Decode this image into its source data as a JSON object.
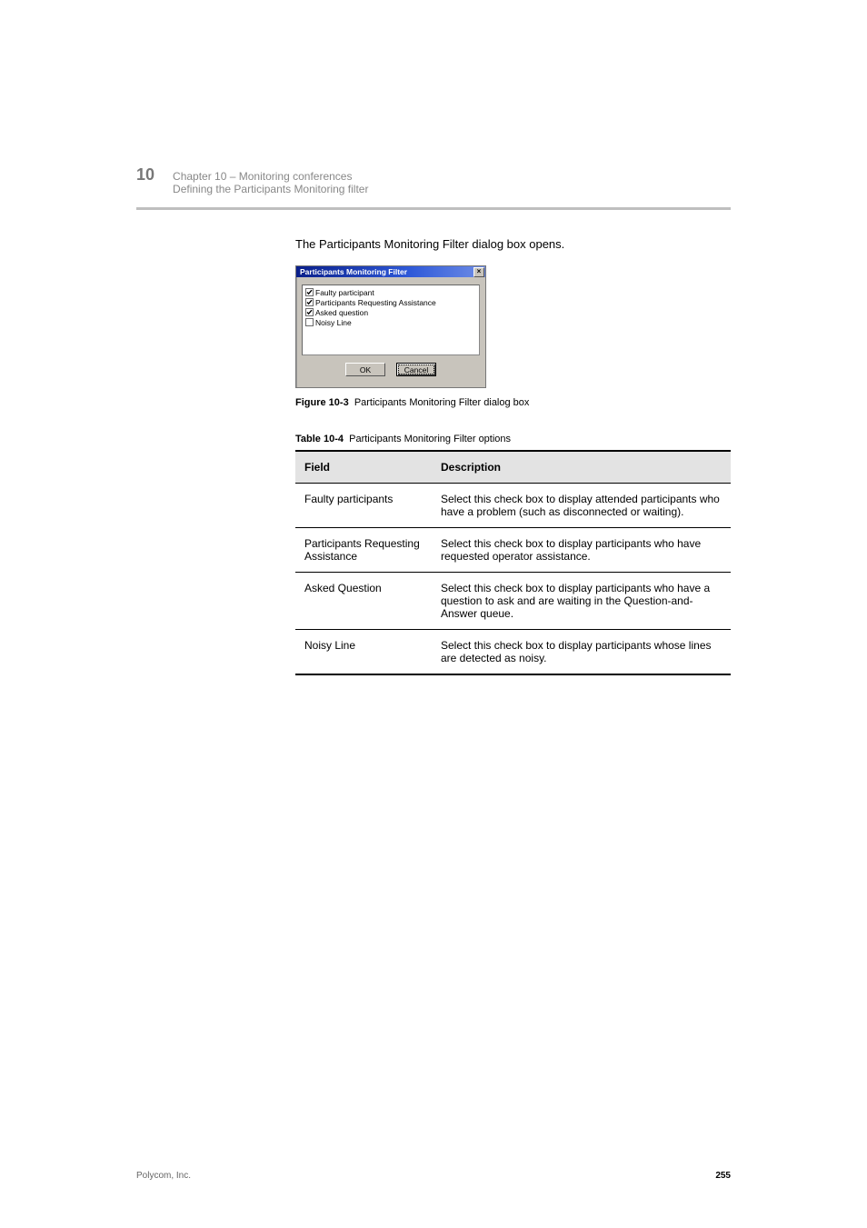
{
  "header": {
    "chapter_number": "10",
    "chapter_title": "Chapter 10 – Monitoring conferences",
    "section": "Defining the Participants Monitoring filter"
  },
  "intro_sentence": "The Participants Monitoring Filter dialog box opens.",
  "dialog": {
    "title": "Participants Monitoring Filter",
    "close": "×",
    "items": [
      {
        "label": "Faulty participant",
        "checked": true
      },
      {
        "label": "Participants Requesting Assistance",
        "checked": true
      },
      {
        "label": "Asked question",
        "checked": true
      },
      {
        "label": "Noisy Line",
        "checked": false
      }
    ],
    "ok": "OK",
    "cancel": "Cancel"
  },
  "figure_caption_label": "Figure 10-3",
  "figure_caption_text": "Participants Monitoring Filter dialog box",
  "table_caption_label": "Table 10-4",
  "table_caption_text": "Participants Monitoring Filter options",
  "table": {
    "columns": [
      "Field",
      "Description"
    ],
    "rows": [
      {
        "field": "Faulty participants",
        "desc": "Select this check box to display attended participants who have a problem (such as disconnected or waiting)."
      },
      {
        "field": "Participants Requesting Assistance",
        "desc": "Select this check box to display participants who have requested operator assistance."
      },
      {
        "field": "Asked Question",
        "desc": "Select this check box to display participants who have a question to ask and are waiting in the Question-and-Answer queue."
      },
      {
        "field": "Noisy Line",
        "desc": "Select this check box to display participants whose lines are detected as noisy."
      }
    ]
  },
  "footer": {
    "doc": "Polycom, Inc.",
    "page": "255"
  }
}
